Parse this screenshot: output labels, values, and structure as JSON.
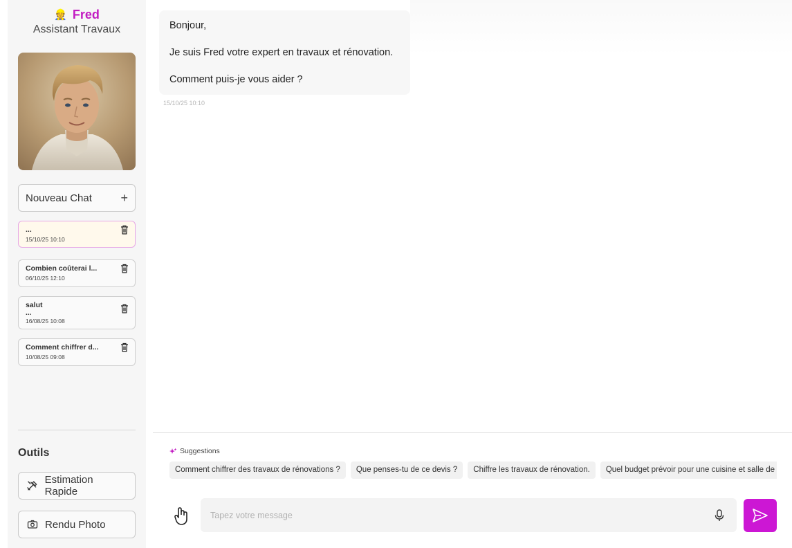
{
  "sidebar": {
    "brand": {
      "emoji": "👷",
      "name": "Fred",
      "subtitle": "Assistant Travaux"
    },
    "avatar_alt": "Fred",
    "new_chat_label": "Nouveau Chat",
    "chats": [
      {
        "title": "...",
        "dots": "",
        "date": "15/10/25 10:10",
        "active": true
      },
      {
        "title": "Combien coûterai l...",
        "dots": "",
        "date": "06/10/25 12:10",
        "active": false
      },
      {
        "title": "salut",
        "dots": "...",
        "date": "16/08/25 10:08",
        "active": false
      },
      {
        "title": "Comment chiffrer d...",
        "dots": "",
        "date": "10/08/25 09:08",
        "active": false
      }
    ],
    "tools_title": "Outils",
    "tools": [
      {
        "label": "Estimation Rapide",
        "icon": "tools-icon"
      },
      {
        "label": "Rendu Photo",
        "icon": "camera-icon"
      }
    ]
  },
  "conversation": {
    "messages": [
      {
        "lines": [
          "Bonjour,",
          "Je suis Fred votre expert en travaux et rénovation.",
          "Comment puis-je vous aider ?"
        ],
        "time": "15/10/25 10:10"
      }
    ]
  },
  "suggestions": {
    "header": "Suggestions",
    "items": [
      "Comment chiffrer des travaux de rénovations ?",
      "Que penses-tu de ce devis ?",
      "Chiffre les travaux de rénovation.",
      "Quel budget prévoir pour une cuisine et salle de bain ?"
    ]
  },
  "composer": {
    "placeholder": "Tapez votre message",
    "value": ""
  },
  "colors": {
    "accent": "#cc17d4",
    "brand": "#c21bc2",
    "active_chat_bg": "#fff9ec"
  }
}
